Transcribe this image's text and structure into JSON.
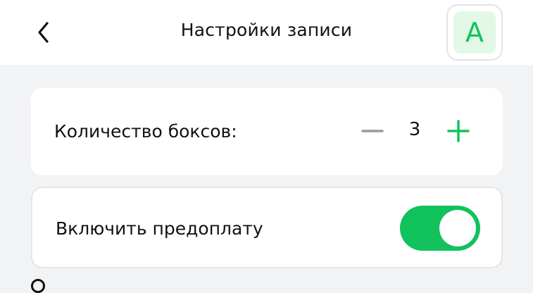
{
  "header": {
    "title": "Настройки записи",
    "back_icon": "chevron-left-icon",
    "avatar_letter": "А"
  },
  "settings": {
    "boxes": {
      "label": "Количество боксов:",
      "value": "3",
      "decrement_icon": "minus-icon",
      "increment_icon": "plus-icon"
    },
    "prepayment": {
      "label": "Включить предоплату",
      "enabled": true
    }
  },
  "colors": {
    "accent": "#11c25c",
    "avatar_bg": "#e3f8e6",
    "page_bg": "#f2f3f5",
    "disabled": "#9a9a9a"
  }
}
